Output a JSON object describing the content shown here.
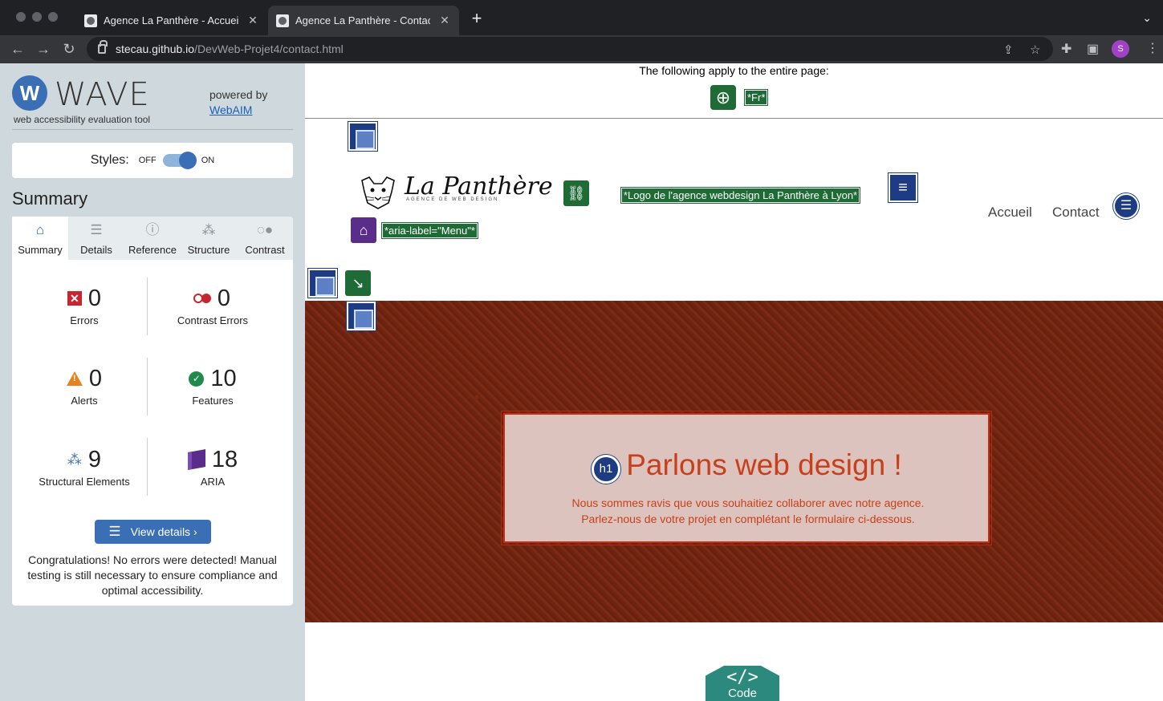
{
  "browser": {
    "tabs": [
      {
        "title": "Agence La Panthère - Accueil",
        "active": false
      },
      {
        "title": "Agence La Panthère - Contact",
        "active": true
      }
    ],
    "url_host": "stecau.github.io",
    "url_path": "/DevWeb-Projet4/contact.html",
    "profile_initial": "S"
  },
  "wave": {
    "title": "WAVE",
    "subtitle": "web accessibility evaluation tool",
    "powered_by": "powered by",
    "webaim_link": "WebAIM",
    "styles_label": "Styles:",
    "styles_off": "OFF",
    "styles_on": "ON",
    "summary_heading": "Summary",
    "tabs": [
      {
        "label": "Summary",
        "icon": "home-icon"
      },
      {
        "label": "Details",
        "icon": "list-icon"
      },
      {
        "label": "Reference",
        "icon": "info-icon"
      },
      {
        "label": "Structure",
        "icon": "sitemap-icon"
      },
      {
        "label": "Contrast",
        "icon": "contrast-toggle-icon"
      }
    ],
    "stats": {
      "errors": {
        "value": "0",
        "label": "Errors"
      },
      "contrast": {
        "value": "0",
        "label": "Contrast Errors"
      },
      "alerts": {
        "value": "0",
        "label": "Alerts"
      },
      "features": {
        "value": "10",
        "label": "Features"
      },
      "structural": {
        "value": "9",
        "label": "Structural Elements"
      },
      "aria": {
        "value": "18",
        "label": "ARIA"
      }
    },
    "view_details": "View details ›",
    "congrats": "Congratulations! No errors were detected! Manual testing is still necessary to ensure compliance and optimal accessibility."
  },
  "page": {
    "applies_text": "The following apply to the entire page:",
    "lang_tag": "*Fr*",
    "logo_alt_tag": "*Logo de l'agence webdesign La Panthère à Lyon*",
    "aria_label_tag": "*aria-label=\"Menu\"*",
    "logo_text": "La Panthère",
    "logo_subtitle": "AGENCE DE WEB DESIGN",
    "nav": [
      "Accueil",
      "Contact"
    ],
    "hero_heading_badge": "h1",
    "hero_title": "Parlons web design !",
    "hero_line1": "Nous sommes ravis que vous souhaitiez collaborer avec notre agence.",
    "hero_line2": "Parlez-nous de votre projet en complétant le formulaire ci-dessous.",
    "code_label": "Code",
    "code_glyph": "</>"
  },
  "colors": {
    "wave_blue": "#3a6eb5",
    "feature_green": "#1e6b35",
    "aria_purple": "#5b2d8a",
    "region_navy": "#1e3c84",
    "hero_orange": "#c8401b"
  }
}
